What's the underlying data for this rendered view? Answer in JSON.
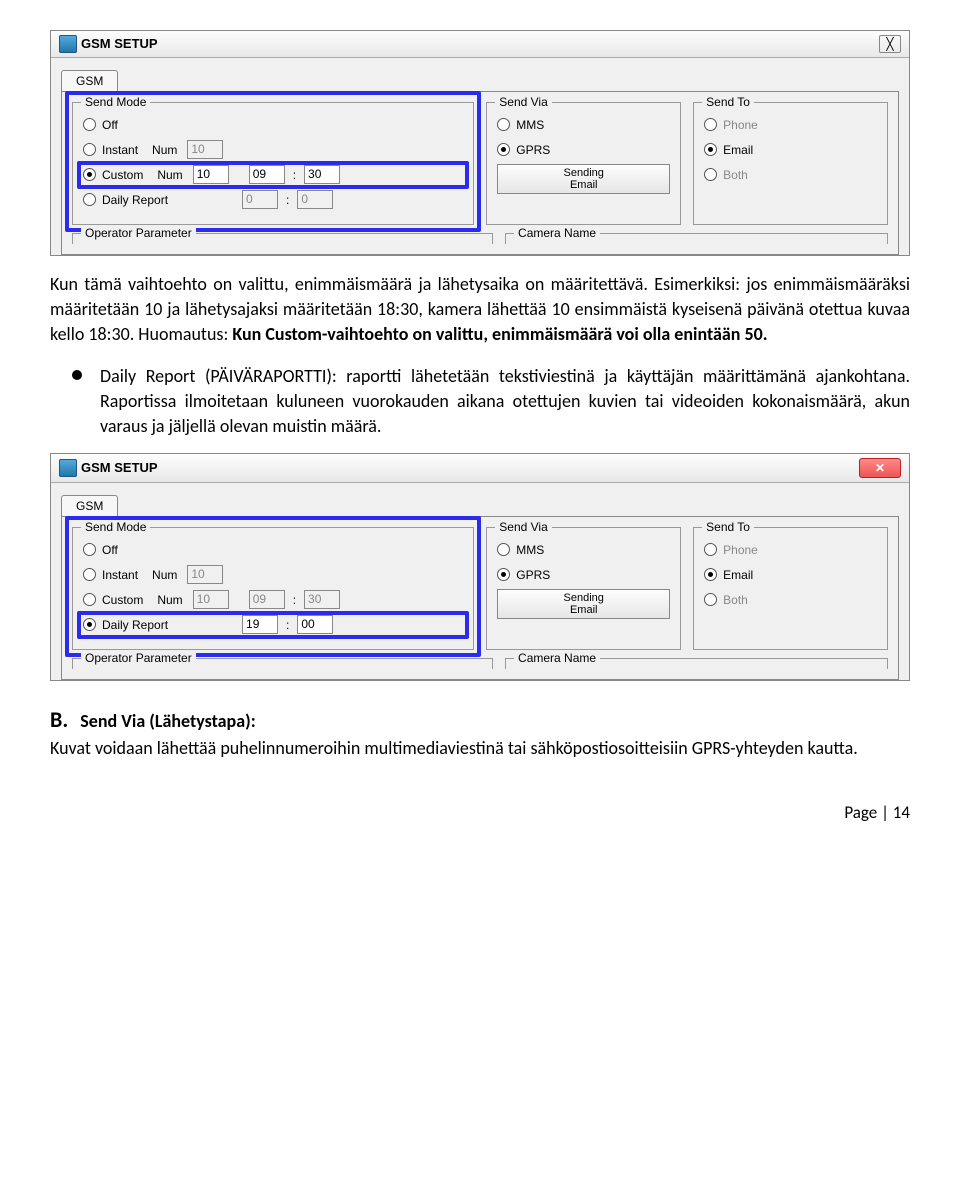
{
  "shot1": {
    "title": "GSM SETUP",
    "tab": "GSM",
    "sendMode": {
      "legend": "Send Mode",
      "off": "Off",
      "instant": "Instant",
      "custom": "Custom",
      "daily": "Daily Report",
      "numLabel": "Num",
      "instantNum": "10",
      "customNum": "10",
      "customH": "09",
      "customM": "30",
      "dailyH": "0",
      "dailyM": "0"
    },
    "sendVia": {
      "legend": "Send Via",
      "mms": "MMS",
      "gprs": "GPRS",
      "btn1": "Sending",
      "btn2": "Email"
    },
    "sendTo": {
      "legend": "Send To",
      "phone": "Phone",
      "email": "Email",
      "both": "Both"
    },
    "opParam": "Operator Parameter",
    "camName": "Camera Name"
  },
  "para1a": "Kun tämä vaihtoehto on valittu, enimmäismäärä ja lähetysaika on määritettävä. Esimerkiksi: jos enimmäismääräksi määritetään 10 ja lähetysajaksi määritetään 18:30, kamera lähettää 10 ensimmäistä kyseisenä päivänä otettua kuvaa kello 18:30. Huomautus: ",
  "para1b": "Kun Custom-vaihtoehto on valittu, enimmäismäärä voi olla enintään 50.",
  "bullet": "Daily Report (PÄIVÄRAPORTTI): raportti lähetetään tekstiviestinä ja käyttäjän määrittämänä ajankohtana. Raportissa ilmoitetaan kuluneen vuorokauden aikana otettujen kuvien tai videoiden kokonaismäärä, akun varaus ja jäljellä olevan muistin määrä.",
  "shot2": {
    "title": "GSM SETUP",
    "tab": "GSM",
    "sendMode": {
      "legend": "Send Mode",
      "off": "Off",
      "instant": "Instant",
      "custom": "Custom",
      "daily": "Daily Report",
      "numLabel": "Num",
      "instantNum": "10",
      "customNum": "10",
      "customH": "09",
      "customM": "30",
      "dailyH": "19",
      "dailyM": "00"
    },
    "sendVia": {
      "legend": "Send Via",
      "mms": "MMS",
      "gprs": "GPRS",
      "btn1": "Sending",
      "btn2": "Email"
    },
    "sendTo": {
      "legend": "Send To",
      "phone": "Phone",
      "email": "Email",
      "both": "Both"
    },
    "opParam": "Operator Parameter",
    "camName": "Camera Name"
  },
  "sectB": {
    "letter": "B.",
    "title": "Send Via (Lähetystapa):",
    "body": "Kuvat voidaan lähettää puhelinnumeroihin multimediaviestinä tai sähköpostiosoitteisiin GPRS-yhteyden kautta."
  },
  "footer": "Page | 14"
}
